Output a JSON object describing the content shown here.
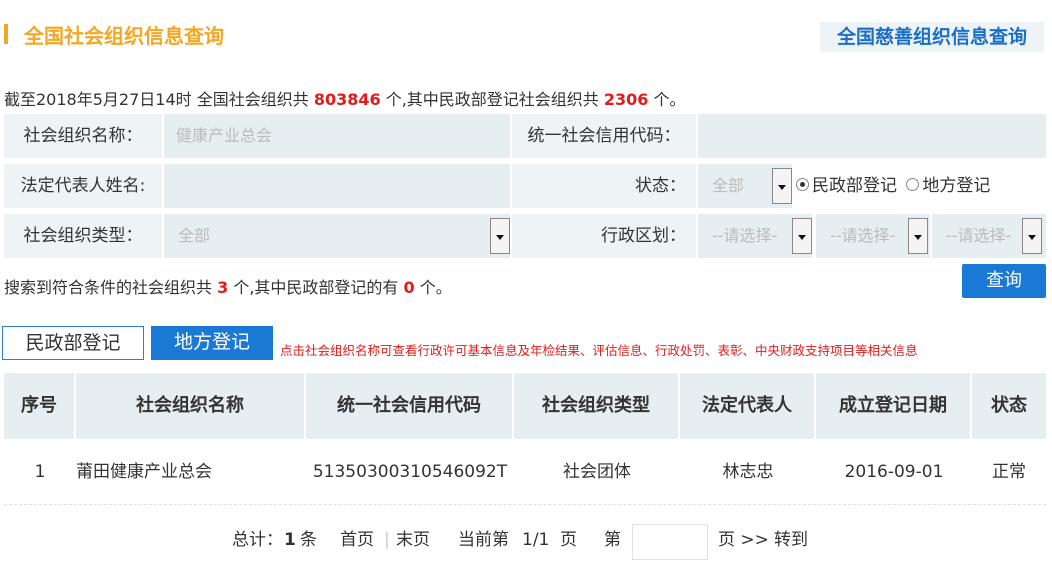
{
  "header": {
    "title": "全国社会组织信息查询",
    "charity_link": "全国慈善组织信息查询"
  },
  "summary": {
    "prefix": "截至2018年5月27日14时 全国社会组织共",
    "total": "803846",
    "mid": "个,其中民政部登记社会组织共",
    "mz_total": "2306",
    "suffix": "个。"
  },
  "form": {
    "org_name_label": "社会组织名称：",
    "org_name_value": "健康产业总会",
    "credit_code_label": "统一社会信用代码：",
    "credit_code_value": "",
    "legal_rep_label": "法定代表人姓名:",
    "legal_rep_value": "",
    "status_label": "状态：",
    "status_value": "全部",
    "radio_mz": "民政部登记",
    "radio_df": "地方登记",
    "org_type_label": "社会组织类型：",
    "org_type_value": "全部",
    "region_label": "行政区划：",
    "region_select_1": "--请选择-",
    "region_select_2": "--请选择-",
    "region_select_3": "--请选择-"
  },
  "results": {
    "prefix": "搜索到符合条件的社会组织共",
    "count": "3",
    "mid": "个,其中民政部登记的有",
    "mz_count": "0",
    "suffix": "个。"
  },
  "query_button": "查询",
  "tabs": {
    "mz": "民政部登记",
    "df": "地方登记"
  },
  "hint": "点击社会组织名称可查看行政许可基本信息及年检结果、评估信息、行政处罚、表彰、中央财政支持项目等相关信息",
  "table": {
    "headers": {
      "no": "序号",
      "name": "社会组织名称",
      "code": "统一社会信用代码",
      "type": "社会组织类型",
      "rep": "法定代表人",
      "date": "成立登记日期",
      "status": "状态"
    },
    "rows": [
      {
        "no": "1",
        "name": "莆田健康产业总会",
        "code": "51350300310546092T",
        "type": "社会团体",
        "rep": "林志忠",
        "date": "2016-09-01",
        "status": "正常"
      }
    ]
  },
  "pager": {
    "total_label": "总计：",
    "total_value": "1",
    "total_unit": "条",
    "first": "首页",
    "sep": "|",
    "last": "末页",
    "current_label": "当前第",
    "current_value": "1/1",
    "current_unit": "页",
    "goto_prefix": "第",
    "goto_suffix": "页 >>",
    "goto": "转到"
  },
  "colors": {
    "accent_orange": "#f5a623",
    "primary_blue": "#1a79d4",
    "highlight_red": "#e31b1b"
  }
}
